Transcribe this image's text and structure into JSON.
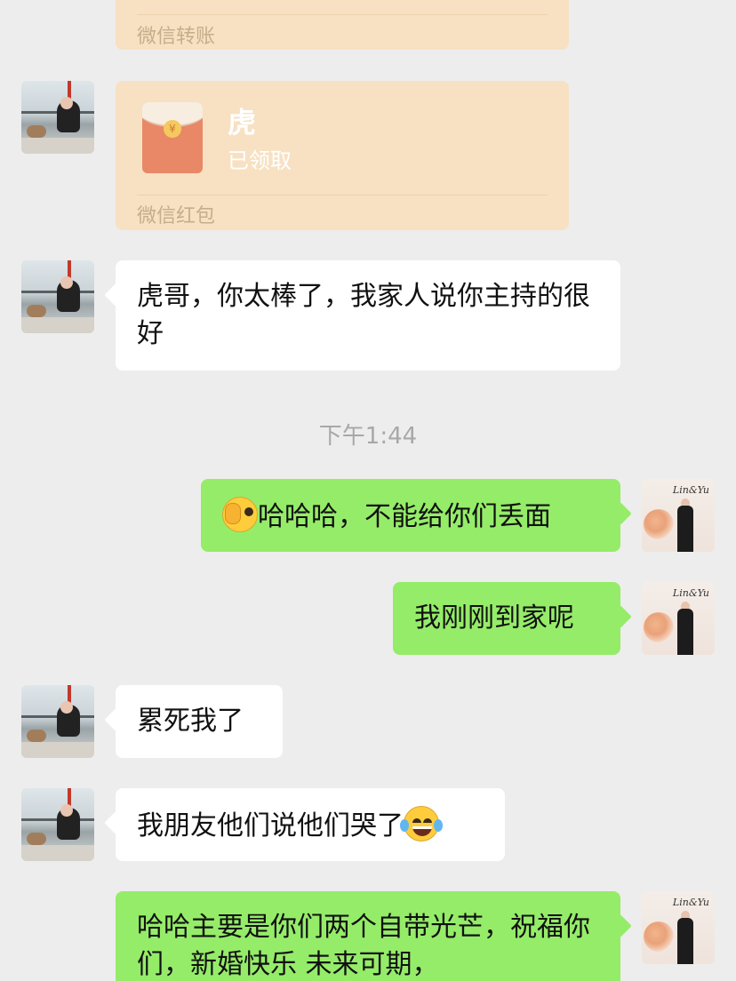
{
  "messages": {
    "transfer_card": {
      "footer": "微信转账"
    },
    "red_packet": {
      "title": "虎",
      "status": "已领取",
      "footer": "微信红包"
    },
    "msg1": "虎哥，你太棒了，我家人说你主持的很好",
    "timestamp": "下午1:44",
    "msg2": "哈哈哈，不能给你们丢面",
    "msg3": "我刚刚到家呢",
    "msg4": "累死我了",
    "msg5": "我朋友他们说他们哭了",
    "msg6": "哈哈主要是你们两个自带光芒，祝福你们，新婚快乐 未来可期，"
  },
  "avatars": {
    "right_signature": "Lin&Yu"
  },
  "icons": {
    "emoji_msg2": "face-with-hand-over-eye-emoji",
    "emoji_msg5": "tears-of-joy-emoji"
  },
  "colors": {
    "background": "#ededed",
    "bubble_sent": "#95ec69",
    "bubble_received": "#ffffff",
    "card": "#f7e1c2",
    "packet_red": "#e98866"
  }
}
